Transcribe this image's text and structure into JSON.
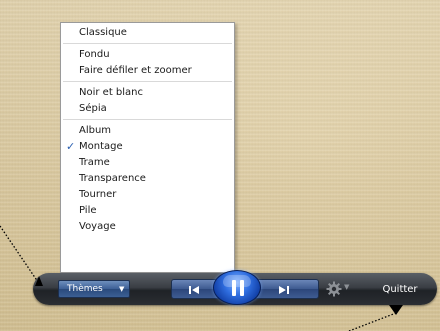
{
  "menu": {
    "groups": [
      [
        {
          "label": "Classique",
          "checked": false
        }
      ],
      [
        {
          "label": "Fondu",
          "checked": false
        },
        {
          "label": "Faire défiler et zoomer",
          "checked": false
        }
      ],
      [
        {
          "label": "Noir et blanc",
          "checked": false
        },
        {
          "label": "Sépia",
          "checked": false
        }
      ],
      [
        {
          "label": "Album",
          "checked": false
        },
        {
          "label": "Montage",
          "checked": true
        },
        {
          "label": "Trame",
          "checked": false
        },
        {
          "label": "Transparence",
          "checked": false
        },
        {
          "label": "Tourner",
          "checked": false
        },
        {
          "label": "Pile",
          "checked": false
        },
        {
          "label": "Voyage",
          "checked": false
        }
      ]
    ],
    "check_glyph": "✓"
  },
  "controls": {
    "themes_label": "Thèmes",
    "themes_caret": "▼",
    "settings_caret": "▼",
    "quit_label": "Quitter",
    "icons": {
      "previous": "skip-previous-icon",
      "pause": "pause-icon",
      "next": "skip-next-icon",
      "settings": "gear-icon"
    }
  },
  "colors": {
    "accent_blue": "#2f6ee0",
    "button_blue": "#3c5f96",
    "bar_dark": "#2b2e33",
    "background": "#e0cfa4"
  }
}
